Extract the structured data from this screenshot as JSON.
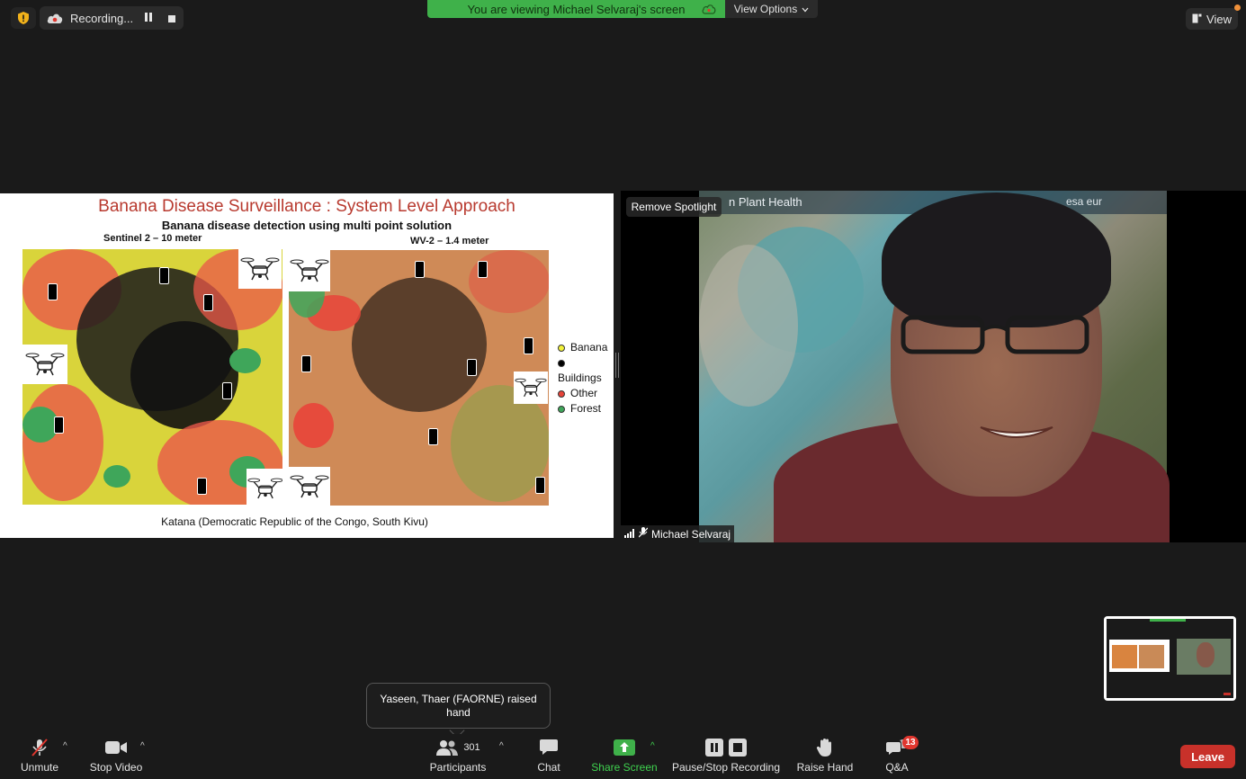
{
  "recording": {
    "label": "Recording..."
  },
  "banner": {
    "text": "You are viewing Michael Selvaraj's screen",
    "view_options": "View Options"
  },
  "view_button": {
    "label": "View"
  },
  "slide": {
    "title": "Banana Disease Surveillance  : System Level Approach",
    "subtitle": "Banana  disease detection using multi point solution",
    "left_map_label": "Sentinel 2 – 10 meter",
    "right_map_label": "WV-2 – 1.4 meter",
    "legend": [
      {
        "label": "Banana",
        "color": "#f2f23a"
      },
      {
        "label": "Buildings",
        "color": "#000000"
      },
      {
        "label": "Other",
        "color": "#e8443a"
      },
      {
        "label": "Forest",
        "color": "#3fa65a"
      }
    ],
    "caption": "Katana (Democratic Republic of the Congo, South Kivu)"
  },
  "video": {
    "remove_spotlight": "Remove Spotlight",
    "background_title": "n Plant Health",
    "background_logos": "esa  eur",
    "participant_name": "Michael Selvaraj"
  },
  "tooltip": {
    "text": "Yaseen, Thaer (FAORNE) raised hand"
  },
  "toolbar": {
    "unmute": "Unmute",
    "stop_video": "Stop Video",
    "participants": "Participants",
    "participants_count": "301",
    "chat": "Chat",
    "share_screen": "Share Screen",
    "pause_stop_recording": "Pause/Stop Recording",
    "raise_hand": "Raise Hand",
    "qa": "Q&A",
    "qa_badge": "13",
    "leave": "Leave"
  },
  "colors": {
    "green": "#3fb14a",
    "leave_red": "#c8312a",
    "badge_red": "#e0362e"
  }
}
